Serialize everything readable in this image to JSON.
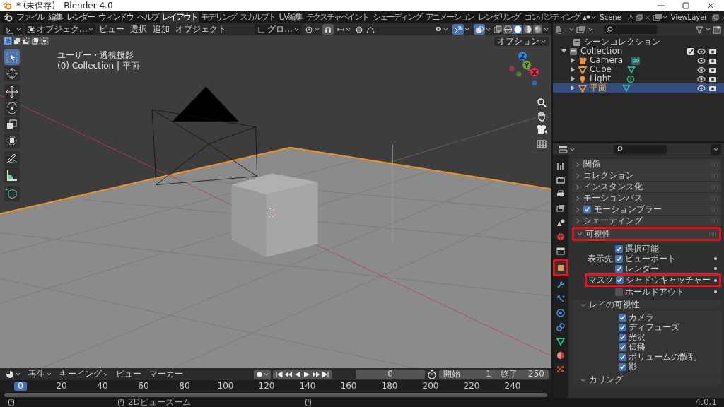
{
  "window": {
    "title": "* (未保存) - Blender 4.0"
  },
  "topbar": {
    "menus": [
      "ファイル",
      "編集",
      "レンダー",
      "ウィンドウ",
      "ヘルプ"
    ],
    "workspaces": [
      {
        "label": "レイアウト",
        "selected": true
      },
      {
        "label": "モデリング",
        "selected": false
      },
      {
        "label": "スカルプト",
        "selected": false
      },
      {
        "label": "UV編集",
        "selected": false
      },
      {
        "label": "テクスチャペイント",
        "selected": false
      },
      {
        "label": "シェーディング",
        "selected": false
      },
      {
        "label": "アニメーション",
        "selected": false
      },
      {
        "label": "レンダリング",
        "selected": false
      },
      {
        "label": "コンポジティング",
        "selected": false
      }
    ],
    "scene": "Scene",
    "view_layer": "ViewLayer"
  },
  "viewport": {
    "header": {
      "mode": "オブジェク...",
      "menus": [
        "ビュー",
        "選択",
        "追加",
        "オブジェクト"
      ],
      "orientation": "グロ...",
      "snap_on": true,
      "gizmos_on": true,
      "overlays_on": true,
      "shading_modes": [
        {
          "selected": false
        },
        {
          "selected": true
        },
        {
          "selected": false
        },
        {
          "selected": false
        }
      ]
    },
    "select_modes": [
      {
        "selected": true
      },
      {
        "selected": false
      },
      {
        "selected": false
      },
      {
        "selected": false
      },
      {
        "selected": false
      }
    ],
    "options": "オプション",
    "tools": [
      {
        "selected": true
      },
      {
        "selected": false
      },
      {
        "selected": false
      },
      {
        "selected": false
      },
      {
        "selected": false
      },
      {
        "selected": false
      },
      {
        "selected": false
      },
      {
        "selected": false
      },
      {
        "selected": false
      }
    ],
    "info": [
      "ユーザー・透視投影",
      "(0) Collection | 平面"
    ],
    "gizmo": [
      {
        "label": "Z",
        "color": "#2f83e3"
      },
      {
        "label": "Y",
        "color": "#6ba32a"
      },
      {
        "label": "X",
        "color": "#e8344d"
      }
    ]
  },
  "outliner": {
    "title": "シーンコレクション",
    "items": [
      {
        "label": "Collection",
        "kind": "collection",
        "expanded": true,
        "checked": true,
        "selected": false,
        "children": [
          {
            "label": "Camera",
            "kind": "camera",
            "expanded": false,
            "selected": false
          },
          {
            "label": "Cube",
            "kind": "mesh",
            "expanded": false,
            "selected": false
          },
          {
            "label": "Light",
            "kind": "light",
            "expanded": false,
            "selected": false
          },
          {
            "label": "平面",
            "kind": "mesh",
            "expanded": false,
            "selected": true
          }
        ]
      }
    ]
  },
  "properties": {
    "tabs": [
      {
        "selected": false,
        "highlighted": false
      },
      {
        "selected": false,
        "highlighted": false
      },
      {
        "selected": false,
        "highlighted": false
      },
      {
        "selected": false,
        "highlighted": false
      },
      {
        "selected": false,
        "highlighted": false
      },
      {
        "selected": false,
        "highlighted": false
      },
      {
        "selected": false,
        "highlighted": false
      },
      {
        "selected": true,
        "highlighted": true
      },
      {
        "selected": false,
        "highlighted": false
      },
      {
        "selected": false,
        "highlighted": false
      },
      {
        "selected": false,
        "highlighted": false
      },
      {
        "selected": false,
        "highlighted": false
      },
      {
        "selected": false,
        "highlighted": false
      },
      {
        "selected": false,
        "highlighted": false
      },
      {
        "selected": false,
        "highlighted": false
      }
    ],
    "panels": [
      {
        "title": "関係",
        "kind": "plain",
        "expanded": false,
        "highlighted": false
      },
      {
        "title": "コレクション",
        "kind": "plain",
        "expanded": false,
        "highlighted": false
      },
      {
        "title": "インスタンス化",
        "kind": "plain",
        "expanded": false,
        "highlighted": false
      },
      {
        "title": "モーションパス",
        "kind": "plain",
        "expanded": false,
        "highlighted": false
      },
      {
        "title": "モーションブラー",
        "kind": "toggle",
        "checked": true,
        "expanded": false,
        "highlighted": false
      },
      {
        "title": "シェーディング",
        "kind": "plain",
        "expanded": false,
        "highlighted": false
      },
      {
        "title": "可視性",
        "kind": "plain",
        "expanded": true,
        "highlighted": true
      }
    ],
    "visibility_rows": [
      {
        "text": "選択可能",
        "checked": true,
        "keyframe_dot": false,
        "highlighted": false
      },
      {
        "label": "表示先",
        "text": "ビューポート",
        "checked": true,
        "keyframe_dot": true,
        "highlighted": false
      },
      {
        "text": "レンダー",
        "checked": true,
        "keyframe_dot": true,
        "highlighted": false
      },
      {
        "label": "マスク",
        "text": "シャドウキャッチャー",
        "checked": true,
        "keyframe_dot": true,
        "highlighted": true
      },
      {
        "text": "ホールドアウト",
        "checked": false,
        "keyframe_dot": true,
        "highlighted": false
      }
    ],
    "subpanels": [
      {
        "title": "レイの可視性",
        "expanded": true,
        "items": [
          {
            "label": "カメラ",
            "checked": true
          },
          {
            "label": "ディフューズ",
            "checked": true
          },
          {
            "label": "光沢",
            "checked": true
          },
          {
            "label": "伝播",
            "checked": true
          },
          {
            "label": "ボリュームの散乱",
            "checked": true
          },
          {
            "label": "影",
            "checked": true
          }
        ]
      },
      {
        "title": "カリング",
        "expanded": true
      }
    ]
  },
  "timeline": {
    "menus": [
      {
        "label": "再生",
        "dropdown": true
      },
      {
        "label": "キーイング",
        "dropdown": true
      },
      {
        "label": "ビュー",
        "dropdown": false
      },
      {
        "label": "マーカー",
        "dropdown": false
      }
    ],
    "current_frame": "0",
    "start_label": "開始",
    "start": "1",
    "end_label": "終了",
    "end": "250",
    "ruler": [
      {
        "label": "0",
        "selected": true
      },
      {
        "label": "20",
        "selected": false
      },
      {
        "label": "40",
        "selected": false
      },
      {
        "label": "60",
        "selected": false
      },
      {
        "label": "80",
        "selected": false
      },
      {
        "label": "100",
        "selected": false
      },
      {
        "label": "120",
        "selected": false
      },
      {
        "label": "140",
        "selected": false
      },
      {
        "label": "160",
        "selected": false
      },
      {
        "label": "180",
        "selected": false
      },
      {
        "label": "200",
        "selected": false
      },
      {
        "label": "220",
        "selected": false
      },
      {
        "label": "240",
        "selected": false
      }
    ]
  },
  "status_bar": {
    "hint": "2Dビューズーム",
    "version": "4.0.1"
  }
}
